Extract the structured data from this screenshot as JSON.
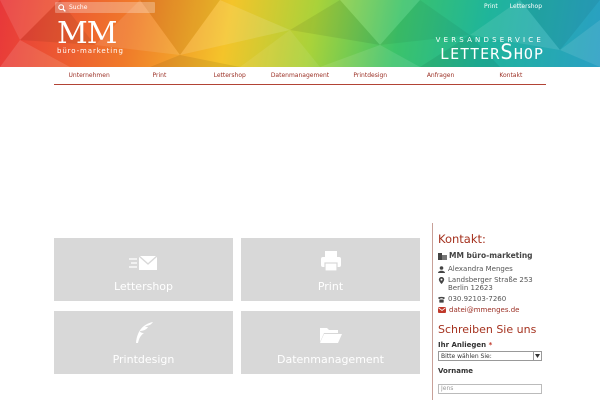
{
  "header": {
    "search_placeholder": "Suche",
    "top_links": [
      "Print",
      "Lettershop"
    ],
    "logo_text": "MM",
    "logo_subtext": "büro-marketing",
    "brand_tagline": "VERSANDSERVICE",
    "brand_name_prefix": "LETTER",
    "brand_name_cap": "S",
    "brand_name_suffix": "HOP"
  },
  "nav": {
    "items": [
      "Unternehmen",
      "Print",
      "Lettershop",
      "Datenmanagement",
      "Printdesign",
      "Anfragen",
      "Kontakt"
    ]
  },
  "tiles": [
    {
      "label": "Lettershop",
      "icon": "envelope-icon"
    },
    {
      "label": "Print",
      "icon": "printer-icon"
    },
    {
      "label": "Printdesign",
      "icon": "feather-icon"
    },
    {
      "label": "Datenmanagement",
      "icon": "folder-open-icon"
    }
  ],
  "sidebar": {
    "contact_heading": "Kontakt:",
    "company": "MM büro-marketing",
    "person": "Alexandra Menges",
    "street": "Landsberger Straße 253",
    "city": "Berlin 12623",
    "phone": "030.92103-7260",
    "email": "datei@mmenges.de",
    "form_heading": "Schreiben Sie uns",
    "concern_label": "Ihr Anliegen",
    "required_mark": "*",
    "concern_selected": "Bitte wählen Sie:",
    "firstname_label": "Vorname",
    "firstname_placeholder": "Jens"
  },
  "colors": {
    "accent": "#a5321f",
    "tile_bg": "#d8d8d8",
    "nav_text": "#9b2f24"
  }
}
